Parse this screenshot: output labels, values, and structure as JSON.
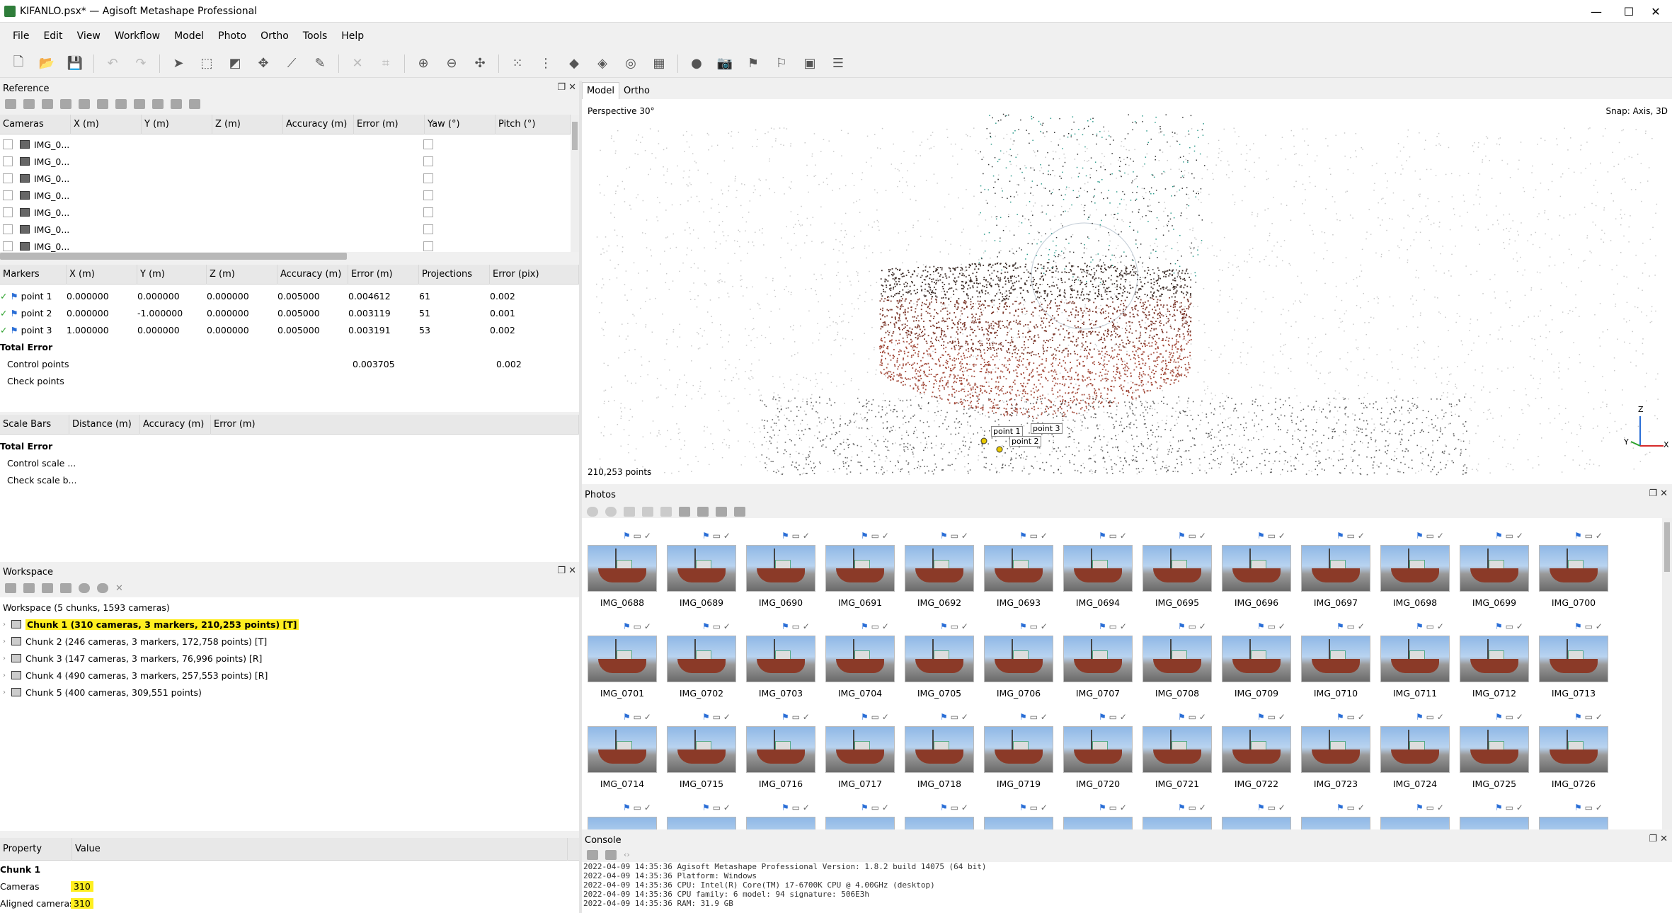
{
  "window": {
    "title": "KIFANLO.psx* — Agisoft Metashape Professional",
    "minimize": "—",
    "maximize": "☐",
    "close": "✕"
  },
  "menu": [
    "File",
    "Edit",
    "View",
    "Workflow",
    "Model",
    "Photo",
    "Ortho",
    "Tools",
    "Help"
  ],
  "reference": {
    "title": "Reference",
    "cameras_columns": [
      "Cameras",
      "X (m)",
      "Y (m)",
      "Z (m)",
      "Accuracy (m)",
      "Error (m)",
      "Yaw (°)",
      "Pitch (°)"
    ],
    "cameras": [
      "IMG_0...",
      "IMG_0...",
      "IMG_0...",
      "IMG_0...",
      "IMG_0...",
      "IMG_0...",
      "IMG_0..."
    ],
    "markers_columns": [
      "Markers",
      "X (m)",
      "Y (m)",
      "Z (m)",
      "Accuracy (m)",
      "Error (m)",
      "Projections",
      "Error (pix)"
    ],
    "markers": [
      {
        "name": "point 1",
        "x": "0.000000",
        "y": "0.000000",
        "z": "0.000000",
        "acc": "0.005000",
        "err": "0.004612",
        "proj": "61",
        "errpix": "0.002"
      },
      {
        "name": "point 2",
        "x": "0.000000",
        "y": "-1.000000",
        "z": "0.000000",
        "acc": "0.005000",
        "err": "0.003119",
        "proj": "51",
        "errpix": "0.001"
      },
      {
        "name": "point 3",
        "x": "1.000000",
        "y": "0.000000",
        "z": "0.000000",
        "acc": "0.005000",
        "err": "0.003191",
        "proj": "53",
        "errpix": "0.002"
      }
    ],
    "total_error": "Total Error",
    "control_points": {
      "label": "Control points",
      "err": "0.003705",
      "errpix": "0.002"
    },
    "check_points": "Check points",
    "scalebars_columns": [
      "Scale Bars",
      "Distance (m)",
      "Accuracy (m)",
      "Error (m)"
    ],
    "scale_total": "Total Error",
    "control_scale": "Control scale ...",
    "check_scale": "Check scale b..."
  },
  "workspace": {
    "title": "Workspace",
    "root": "Workspace (5 chunks, 1593 cameras)",
    "chunks": [
      "Chunk 1 (310 cameras, 3 markers, 210,253 points) [T]",
      "Chunk 2 (246 cameras, 3 markers, 172,758 points) [T]",
      "Chunk 3 (147 cameras, 3 markers, 76,996 points) [R]",
      "Chunk 4 (490 cameras, 3 markers, 257,553 points) [R]",
      "Chunk 5 (400 cameras, 309,551 points)"
    ]
  },
  "properties": {
    "col_property": "Property",
    "col_value": "Value",
    "section": "Chunk 1",
    "rows": [
      {
        "k": "Cameras",
        "v": "310"
      },
      {
        "k": "Aligned cameras",
        "v": "310"
      }
    ]
  },
  "view": {
    "tabs": [
      "Model",
      "Ortho"
    ],
    "perspective": "Perspective 30°",
    "snap": "Snap: Axis, 3D",
    "points": "210,253 points",
    "markers": [
      "point 1",
      "point 2",
      "point 3"
    ],
    "axes": [
      "Z",
      "Y",
      "X"
    ]
  },
  "photos": {
    "title": "Photos",
    "rows": [
      [
        "IMG_0688",
        "IMG_0689",
        "IMG_0690",
        "IMG_0691",
        "IMG_0692",
        "IMG_0693",
        "IMG_0694",
        "IMG_0695",
        "IMG_0696",
        "IMG_0697",
        "IMG_0698",
        "IMG_0699",
        "IMG_0700"
      ],
      [
        "IMG_0701",
        "IMG_0702",
        "IMG_0703",
        "IMG_0704",
        "IMG_0705",
        "IMG_0706",
        "IMG_0707",
        "IMG_0708",
        "IMG_0709",
        "IMG_0710",
        "IMG_0711",
        "IMG_0712",
        "IMG_0713"
      ],
      [
        "IMG_0714",
        "IMG_0715",
        "IMG_0716",
        "IMG_0717",
        "IMG_0718",
        "IMG_0719",
        "IMG_0720",
        "IMG_0721",
        "IMG_0722",
        "IMG_0723",
        "IMG_0724",
        "IMG_0725",
        "IMG_0726"
      ]
    ]
  },
  "console": {
    "title": "Console",
    "lines": [
      "2022-04-09 14:35:36 Agisoft Metashape Professional Version: 1.8.2 build 14075 (64 bit)",
      "2022-04-09 14:35:36 Platform: Windows",
      "2022-04-09 14:35:36 CPU: Intel(R) Core(TM) i7-6700K CPU @ 4.00GHz (desktop)",
      "2022-04-09 14:35:36 CPU family: 6 model: 94 signature: 506E3h",
      "2022-04-09 14:35:36 RAM: 31.9 GB"
    ]
  },
  "colors": {
    "highlight": "#ffee20",
    "flag": "#2a6ed6",
    "check": "#2aa02a",
    "hull": "#8b3a28"
  }
}
